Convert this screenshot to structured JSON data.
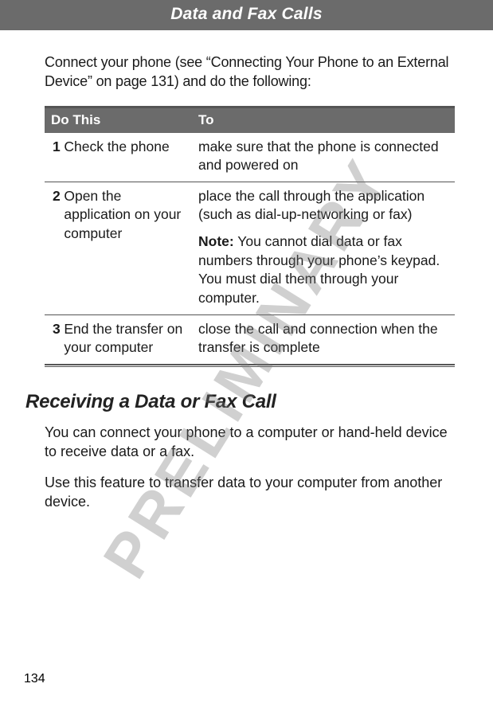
{
  "header": {
    "title": "Data and Fax Calls"
  },
  "watermark": "PRELIMINARY",
  "intro": "Connect your phone (see “Connecting Your Phone to an External Device” on page 131) and do the following:",
  "table": {
    "head": {
      "do": "Do This",
      "to": "To"
    },
    "rows": [
      {
        "num": "1",
        "do": "Check the phone",
        "to": "make sure that the phone is connected and powered on"
      },
      {
        "num": "2",
        "do": "Open the application on your computer",
        "to": "place the call through the application (such as dial-up-networking or fax)",
        "note_label": "Note:",
        "note": " You cannot dial data or fax numbers through your phone’s keypad. You must dial them through your computer."
      },
      {
        "num": "3",
        "do": "End the transfer on your computer",
        "to": "close the call and connection when the transfer is complete"
      }
    ]
  },
  "section": {
    "heading": "Receiving a Data or Fax Call",
    "p1": "You can connect your phone to a computer or hand-held device to receive data or a fax.",
    "p2": "Use this feature to transfer data to your computer from another device."
  },
  "page_number": "134"
}
